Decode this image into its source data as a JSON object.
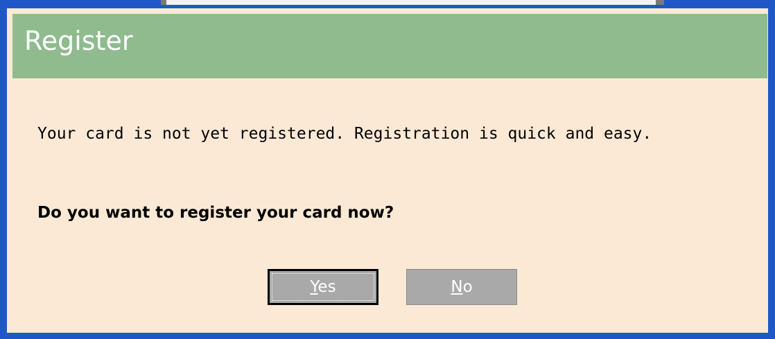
{
  "dialog": {
    "title": "Register",
    "message": "Your card is not yet registered. Registration is quick and easy.",
    "question": "Do you want to register your card now?",
    "buttons": {
      "yes": {
        "mnemonic": "Y",
        "rest": "es"
      },
      "no": {
        "mnemonic": "N",
        "rest": "o"
      }
    }
  },
  "colors": {
    "frame": "#1f57c8",
    "titlebar": "#8fbb8f",
    "background": "#fbe9d5",
    "button": "#a9a9a9"
  }
}
